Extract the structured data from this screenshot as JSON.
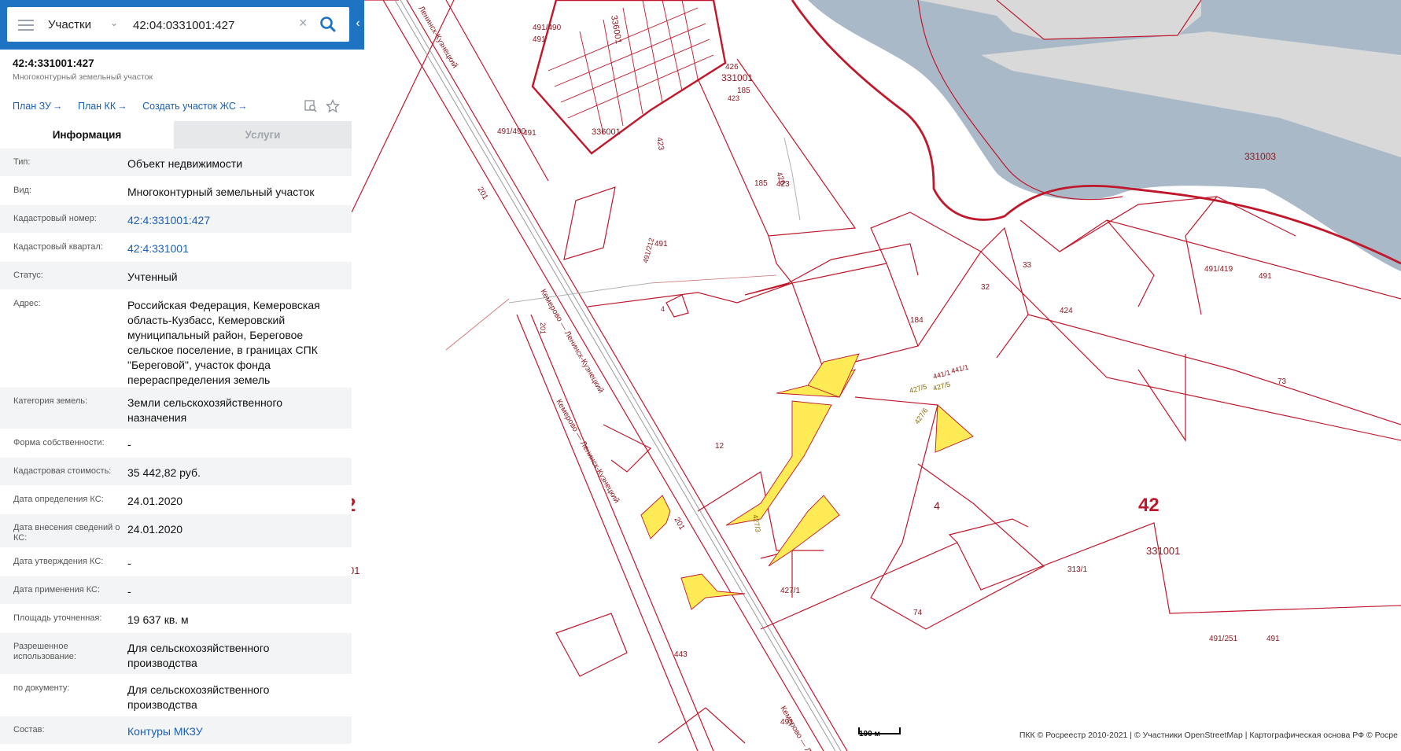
{
  "search": {
    "layer": "Участки",
    "query": "42:04:0331001:427"
  },
  "card": {
    "title": "42:4:331001:427",
    "subtitle": "Многоконтурный земельный участок",
    "links": [
      "План ЗУ",
      "План КК",
      "Создать участок ЖС"
    ],
    "tabs": {
      "info": "Информация",
      "services": "Услуги"
    },
    "rows": [
      {
        "label": "Тип:",
        "value": "Объект недвижимости",
        "link": false
      },
      {
        "label": "Вид:",
        "value": "Многоконтурный земельный участок",
        "link": false
      },
      {
        "label": "Кадастровый номер:",
        "value": "42:4:331001:427",
        "link": true
      },
      {
        "label": "Кадастровый квартал:",
        "value": "42:4:331001",
        "link": true
      },
      {
        "label": "Статус:",
        "value": "Учтенный",
        "link": false
      },
      {
        "label": "Адрес:",
        "value": "Российская Федерация, Кемеровская область-Кузбасс, Кемеровский муниципальный район, Береговое сельское поселение, в границах СПК \"Береговой\", участок фонда перераспределения земель",
        "link": false
      },
      {
        "label": "Категория земель:",
        "value": "Земли сельскохозяйственного назначения",
        "link": false
      },
      {
        "label": "Форма собственности:",
        "value": "-",
        "link": false
      },
      {
        "label": "Кадастровая стоимость:",
        "value": "35 442,82 руб.",
        "link": false
      },
      {
        "label": "Дата определения КС:",
        "value": "24.01.2020",
        "link": false
      },
      {
        "label": "Дата внесения сведений о КС:",
        "value": "24.01.2020",
        "link": false
      },
      {
        "label": "Дата утверждения КС:",
        "value": "-",
        "link": false
      },
      {
        "label": "Дата применения КС:",
        "value": "-",
        "link": false
      },
      {
        "label": "Площадь уточненная:",
        "value": "19 637 кв. м",
        "link": false
      },
      {
        "label": "Разрешенное использование:",
        "value": "Для сельскохозяйственного производства",
        "link": false
      },
      {
        "label": "по документу:",
        "value": "Для сельскохозяйственного производства",
        "link": false
      },
      {
        "label": "Состав:",
        "value": "Контуры МКЗУ",
        "link": true
      }
    ]
  },
  "map": {
    "labels": [
      "491/490",
      "491",
      "491/490",
      "491",
      "201",
      "201",
      "201",
      "Кемерово — Ленинск-Кузнецкий",
      "Кемерово — Ленинск-Кузнецкий",
      "Ленинск-Кузнецкий",
      "Кемерово — Лени",
      "336001",
      "336001",
      "331001",
      "331003",
      "185",
      "185",
      "423",
      "423",
      "423",
      "426",
      "426",
      "491",
      "491/212",
      "4",
      "33",
      "32",
      "184",
      "424",
      "491/419",
      "491",
      "73",
      "441/1",
      "441/1",
      "427/5",
      "427/5",
      "427/6",
      "12",
      "427/3",
      "4",
      "42",
      "331001",
      "313/1",
      "427/1",
      "74",
      "491/251",
      "491",
      "443",
      "491",
      "2",
      "01"
    ],
    "scale": "100 м",
    "attribution": "ПКК © Росреестр 2010-2021 | © Участники OpenStreetMap | Картографическая основа РФ © Росре",
    "colors": {
      "boundary": "#c0172b",
      "water": "#aab9c8",
      "plot": "#ffeb55",
      "road": "#b0b0b0"
    }
  }
}
